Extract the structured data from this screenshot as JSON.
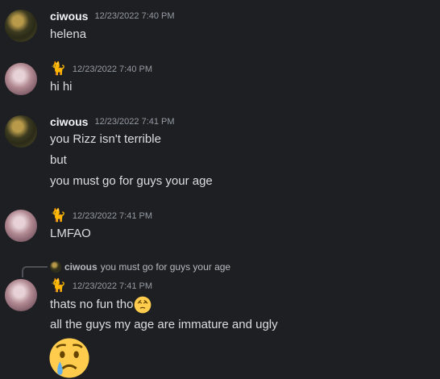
{
  "messages": [
    {
      "author": "ciwous",
      "timestamp": "12/23/2022 7:40 PM",
      "lines": [
        "helena"
      ]
    },
    {
      "author_icon": "🐈",
      "timestamp": "12/23/2022 7:40 PM",
      "lines": [
        "hi hi"
      ]
    },
    {
      "author": "ciwous",
      "timestamp": "12/23/2022 7:41 PM",
      "lines": [
        "you Rizz isn't terrible",
        "but",
        "you must go for guys your age"
      ]
    },
    {
      "author_icon": "🐈",
      "timestamp": "12/23/2022 7:41 PM",
      "lines": [
        "LMFAO"
      ]
    },
    {
      "reply": {
        "author": "ciwous",
        "text": "you must go for guys your age"
      },
      "author_icon": "🐈",
      "timestamp": "12/23/2022 7:41 PM",
      "lines": [
        "thats no fun tho",
        "all the guys my age are immature and ugly"
      ]
    }
  ],
  "emojis": {
    "relieved": "relieved-face",
    "crying": "crying-face"
  },
  "colors": {
    "background": "#1e1f22",
    "username": "#f2f3f5",
    "timestamp": "#949ba4",
    "text": "#dbdee1"
  }
}
